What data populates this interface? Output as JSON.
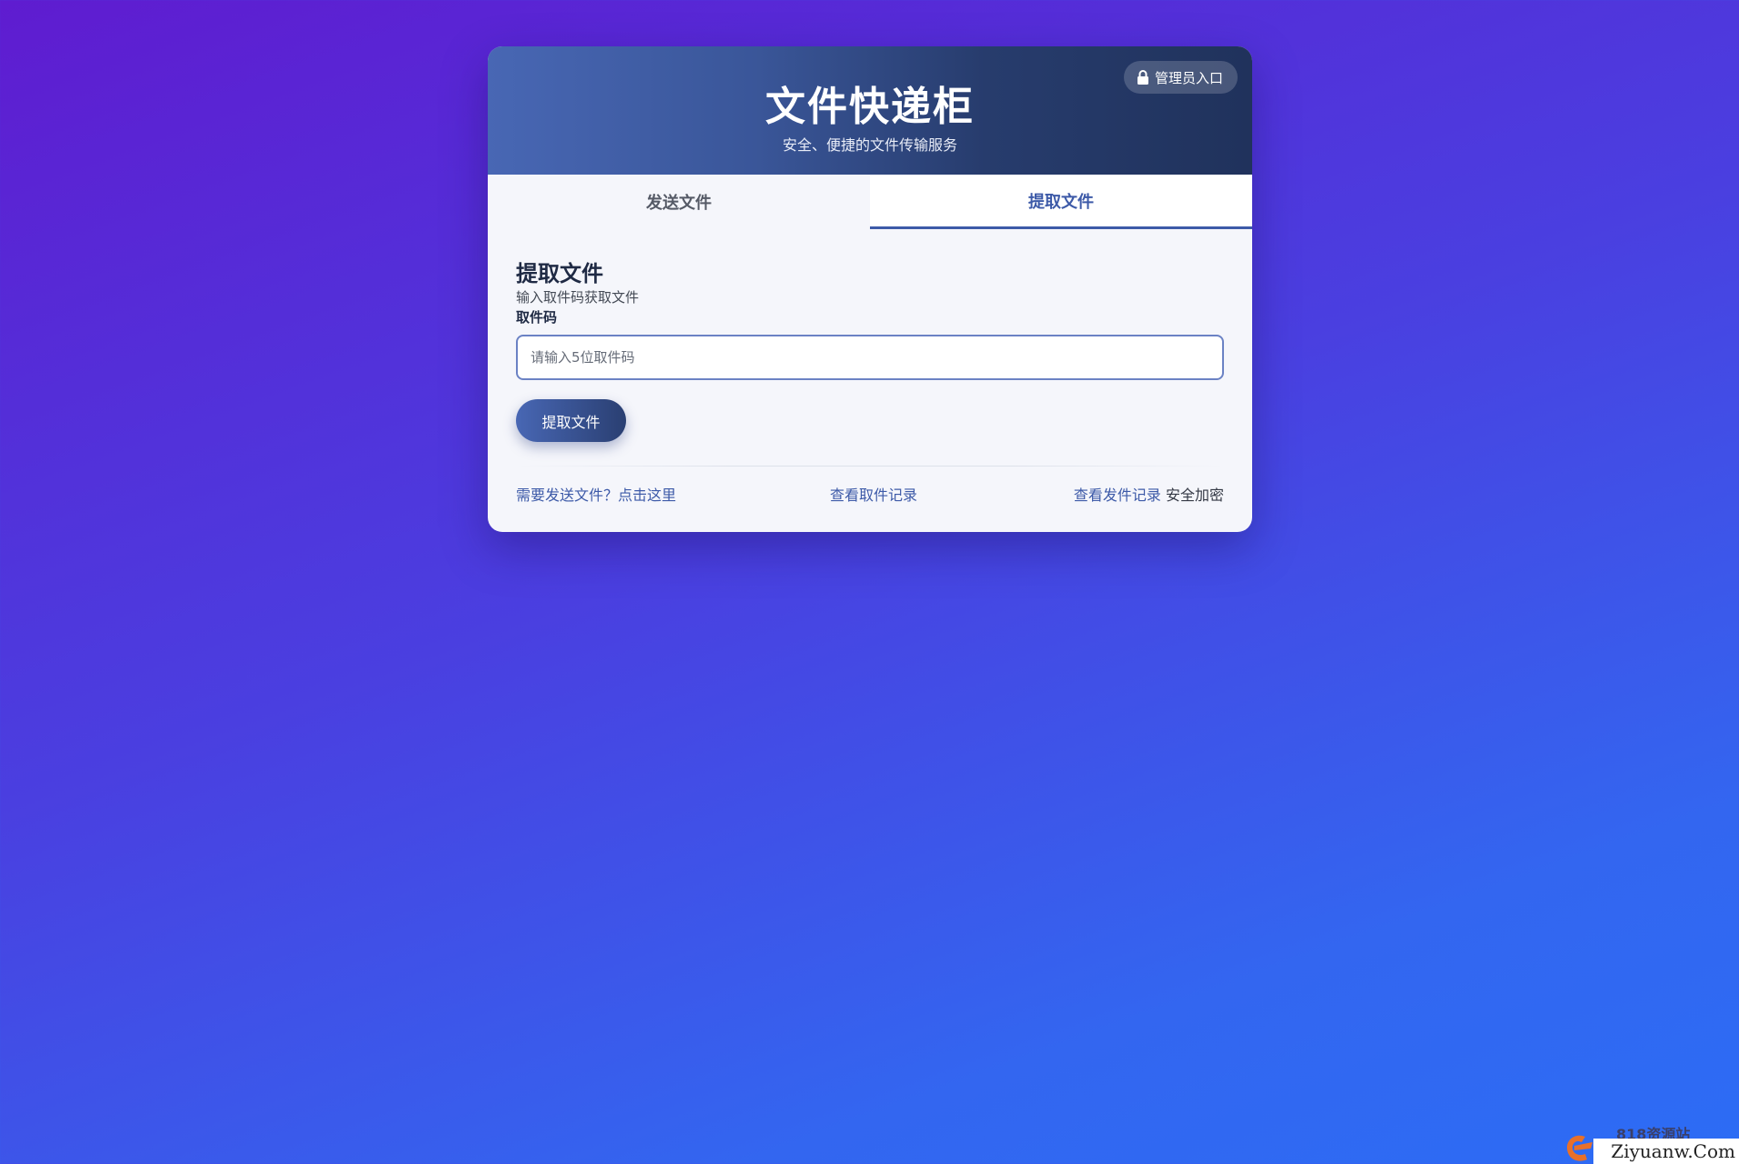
{
  "header": {
    "title": "文件快递柜",
    "subtitle": "安全、便捷的文件传输服务",
    "admin_label": "管理员入口"
  },
  "tabs": [
    {
      "label": "发送文件",
      "active": false
    },
    {
      "label": "提取文件",
      "active": true
    }
  ],
  "retrieve": {
    "title": "提取文件",
    "description": "输入取件码获取文件",
    "field_label": "取件码",
    "input_placeholder": "请输入5位取件码",
    "input_value": "",
    "submit_label": "提取文件"
  },
  "footer": {
    "send_link": "需要发送文件？点击这里",
    "pickup_history_link": "查看取件记录",
    "send_history_link": "查看发件记录",
    "security_text": "安全加密"
  },
  "watermark": {
    "cn": "818资源站",
    "en": "Ziyuanw.Com"
  },
  "colors": {
    "accent": "#3d5aa8",
    "header_start": "#4867b4",
    "header_end": "#20325c"
  }
}
